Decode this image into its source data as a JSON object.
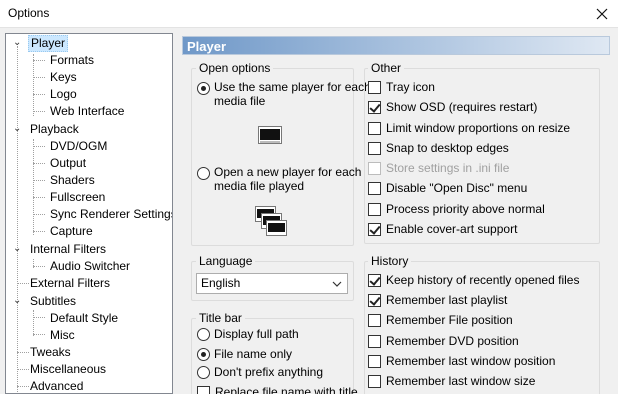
{
  "window": {
    "title": "Options"
  },
  "tree": {
    "items": [
      {
        "label": "Player",
        "name": "tree-item-player"
      },
      {
        "label": "Formats",
        "name": "tree-item-formats"
      },
      {
        "label": "Keys",
        "name": "tree-item-keys"
      },
      {
        "label": "Logo",
        "name": "tree-item-logo"
      },
      {
        "label": "Web Interface",
        "name": "tree-item-web-interface"
      },
      {
        "label": "Playback",
        "name": "tree-item-playback"
      },
      {
        "label": "DVD/OGM",
        "name": "tree-item-dvd-ogm"
      },
      {
        "label": "Output",
        "name": "tree-item-output"
      },
      {
        "label": "Shaders",
        "name": "tree-item-shaders"
      },
      {
        "label": "Fullscreen",
        "name": "tree-item-fullscreen"
      },
      {
        "label": "Sync Renderer Settings",
        "name": "tree-item-sync-renderer"
      },
      {
        "label": "Capture",
        "name": "tree-item-capture"
      },
      {
        "label": "Internal Filters",
        "name": "tree-item-internal-filters"
      },
      {
        "label": "Audio Switcher",
        "name": "tree-item-audio-switcher"
      },
      {
        "label": "External Filters",
        "name": "tree-item-external-filters"
      },
      {
        "label": "Subtitles",
        "name": "tree-item-subtitles"
      },
      {
        "label": "Default Style",
        "name": "tree-item-default-style"
      },
      {
        "label": "Misc",
        "name": "tree-item-misc"
      },
      {
        "label": "Tweaks",
        "name": "tree-item-tweaks"
      },
      {
        "label": "Miscellaneous",
        "name": "tree-item-miscellaneous"
      },
      {
        "label": "Advanced",
        "name": "tree-item-advanced"
      }
    ]
  },
  "page": {
    "title": "Player"
  },
  "open_options": {
    "title": "Open options",
    "same_player": "Use the same player for each media file",
    "same_player_line1": "Use the same player for each",
    "same_player_line2": "media file",
    "new_player_line1": "Open a new player for each",
    "new_player_line2": "media file played"
  },
  "other": {
    "title": "Other",
    "items": [
      {
        "label": "Tray icon",
        "checked": false
      },
      {
        "label": "Show OSD (requires restart)",
        "checked": true
      },
      {
        "label": "Limit window proportions on resize",
        "checked": false
      },
      {
        "label": "Snap to desktop edges",
        "checked": false
      },
      {
        "label": "Store settings in .ini file",
        "checked": false,
        "disabled": true
      },
      {
        "label": "Disable \"Open Disc\" menu",
        "checked": false
      },
      {
        "label": "Process priority above normal",
        "checked": false
      },
      {
        "label": "Enable cover-art support",
        "checked": true
      }
    ]
  },
  "language": {
    "title": "Language",
    "value": "English"
  },
  "history": {
    "title": "History",
    "items": [
      {
        "label": "Keep history of recently opened files",
        "checked": true
      },
      {
        "label": "Remember last playlist",
        "checked": true
      },
      {
        "label": "Remember File position",
        "checked": false
      },
      {
        "label": "Remember DVD position",
        "checked": false
      },
      {
        "label": "Remember last window position",
        "checked": false
      },
      {
        "label": "Remember last window size",
        "checked": false
      }
    ]
  },
  "title_bar": {
    "title": "Title bar",
    "options": [
      {
        "label": "Display full path",
        "selected": false
      },
      {
        "label": "File name only",
        "selected": true
      },
      {
        "label": "Don't prefix anything",
        "selected": false
      }
    ],
    "replace_label": "Replace file name with title"
  }
}
